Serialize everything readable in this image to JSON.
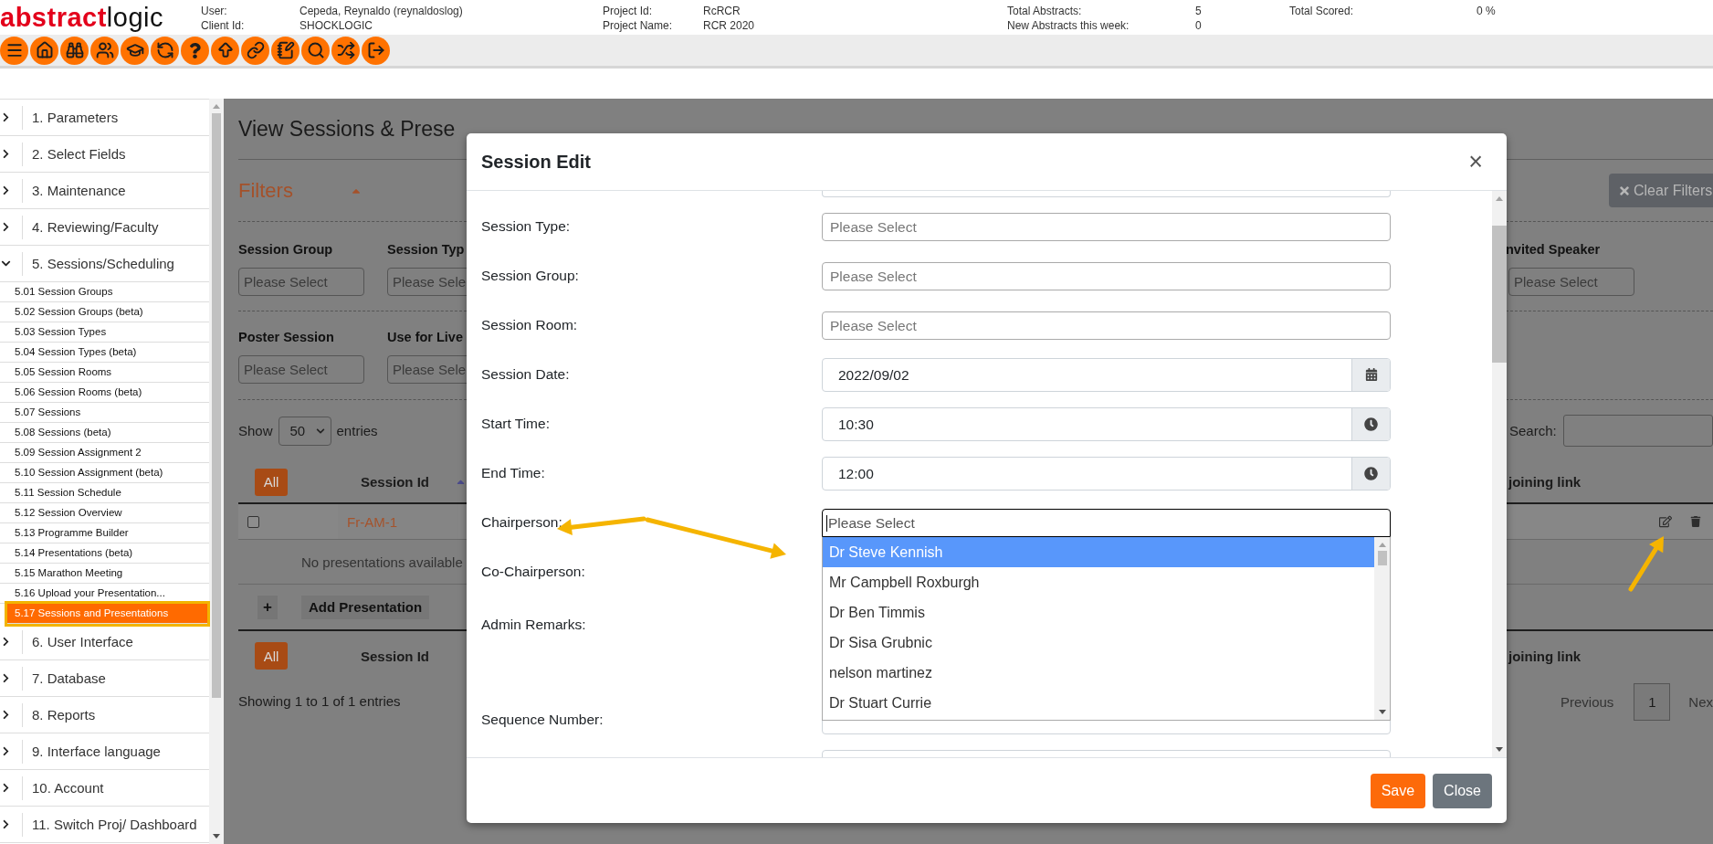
{
  "header": {
    "logo": {
      "first": "abstract",
      "second": "logic"
    },
    "info_columns": [
      [
        {
          "label": "User:",
          "value": "Cepeda, Reynaldo (reynaldoslog)"
        },
        {
          "label": "Client Id:",
          "value": "SHOCKLOGIC"
        }
      ],
      [
        {
          "label": "Project Id:",
          "value": "RcRCR"
        },
        {
          "label": "Project Name:",
          "value": "RCR 2020"
        }
      ],
      [
        {
          "label": "Total Abstracts:",
          "value": "5"
        },
        {
          "label": "New Abstracts this week:",
          "value": "0"
        }
      ],
      [
        {
          "label": "Total Scored:",
          "value": "0 %"
        }
      ]
    ]
  },
  "sidebar": {
    "items": [
      {
        "label": "1. Parameters",
        "expanded": false
      },
      {
        "label": "2. Select Fields",
        "expanded": false
      },
      {
        "label": "3. Maintenance",
        "expanded": false
      },
      {
        "label": "4. Reviewing/Faculty",
        "expanded": false
      },
      {
        "label": "5. Sessions/Scheduling",
        "expanded": true,
        "children": [
          {
            "label": "5.01 Session Groups",
            "selected": false
          },
          {
            "label": "5.02 Session Groups (beta)",
            "selected": false
          },
          {
            "label": "5.03 Session Types",
            "selected": false
          },
          {
            "label": "5.04 Session Types (beta)",
            "selected": false
          },
          {
            "label": "5.05 Session Rooms",
            "selected": false
          },
          {
            "label": "5.06 Session Rooms (beta)",
            "selected": false
          },
          {
            "label": "5.07 Sessions",
            "selected": false
          },
          {
            "label": "5.08 Sessions (beta)",
            "selected": false
          },
          {
            "label": "5.09 Session Assignment 2",
            "selected": false
          },
          {
            "label": "5.10 Session Assignment (beta)",
            "selected": false
          },
          {
            "label": "5.11 Session Schedule",
            "selected": false
          },
          {
            "label": "5.12 Session Overview",
            "selected": false
          },
          {
            "label": "5.13 Programme Builder",
            "selected": false
          },
          {
            "label": "5.14 Presentations (beta)",
            "selected": false
          },
          {
            "label": "5.15 Marathon Meeting",
            "selected": false
          },
          {
            "label": "5.16 Upload your Presentation...",
            "selected": false
          },
          {
            "label": "5.17 Sessions and Presentations",
            "selected": true
          }
        ]
      },
      {
        "label": "6. User Interface",
        "expanded": false
      },
      {
        "label": "7. Database",
        "expanded": false
      },
      {
        "label": "8. Reports",
        "expanded": false
      },
      {
        "label": "9. Interface language",
        "expanded": false
      },
      {
        "label": "10. Account",
        "expanded": false
      },
      {
        "label": "11. Switch Proj/ Dashboard",
        "expanded": false
      }
    ]
  },
  "page": {
    "title": "View Sessions & Prese",
    "filters": {
      "label": "Filters",
      "expanded": true
    },
    "clear_filters": "Clear Filters",
    "filter_rows": [
      [
        {
          "label": "Session Group",
          "placeholder": "Please Select"
        },
        {
          "label": "Session Typ",
          "placeholder": "Please Sele"
        }
      ],
      [
        {
          "label": "Poster Session",
          "placeholder": "Please Select"
        },
        {
          "label": "Use for Live",
          "placeholder": "Please Sele"
        }
      ]
    ],
    "right_filter": {
      "label": "nvited Speaker",
      "placeholder": "Please Select"
    },
    "length": {
      "prefix": "Show",
      "value": "50",
      "suffix": "entries"
    },
    "search_label": "Search:",
    "table": {
      "all_button": "All",
      "column": "Session Id",
      "right_column": "joining link",
      "row": {
        "checked": false,
        "session_id": "Fr-AM-1"
      },
      "empty_note": "No presentations available",
      "add_button": {
        "icon": "+",
        "label": "Add Presentation"
      }
    },
    "footer": {
      "all_button": "All",
      "column": "Session Id",
      "right_column": "joining link",
      "info": "Showing 1 to 1 of 1 entries",
      "previous": "Previous",
      "pages": [
        {
          "label": "1",
          "selected": true
        }
      ],
      "next": "Nex"
    }
  },
  "modal": {
    "title": "Session Edit",
    "close": "×",
    "fields": [
      {
        "label": "Session Type:",
        "kind": "select",
        "placeholder": "Please Select",
        "open": false
      },
      {
        "label": "Session Group:",
        "kind": "select",
        "placeholder": "Please Select",
        "open": false
      },
      {
        "label": "Session Room:",
        "kind": "select",
        "placeholder": "Please Select",
        "open": false
      },
      {
        "label": "Session Date:",
        "kind": "date",
        "value": "2022/09/02"
      },
      {
        "label": "Start Time:",
        "kind": "time",
        "value": "10:30"
      },
      {
        "label": "End Time:",
        "kind": "time",
        "value": "12:00"
      },
      {
        "label": "Chairperson:",
        "kind": "select",
        "placeholder": "Please Select",
        "open": true,
        "options": [
          {
            "label": "Dr Steve Kennish",
            "selected": true
          },
          {
            "label": "Mr Campbell Roxburgh",
            "selected": false
          },
          {
            "label": "Dr Ben Timmis",
            "selected": false
          },
          {
            "label": "Dr Sisa Grubnic",
            "selected": false
          },
          {
            "label": "nelson martinez",
            "selected": false
          },
          {
            "label": "Dr Stuart Currie",
            "selected": false
          }
        ]
      },
      {
        "label": "Co-Chairperson:",
        "kind": "label"
      },
      {
        "label": "Admin Remarks:",
        "kind": "remarks"
      },
      {
        "label": "Sequence Number:",
        "kind": "input"
      }
    ],
    "buttons": [
      {
        "label": "Save",
        "kind": "primary"
      },
      {
        "label": "Close",
        "kind": "secondary"
      }
    ]
  }
}
